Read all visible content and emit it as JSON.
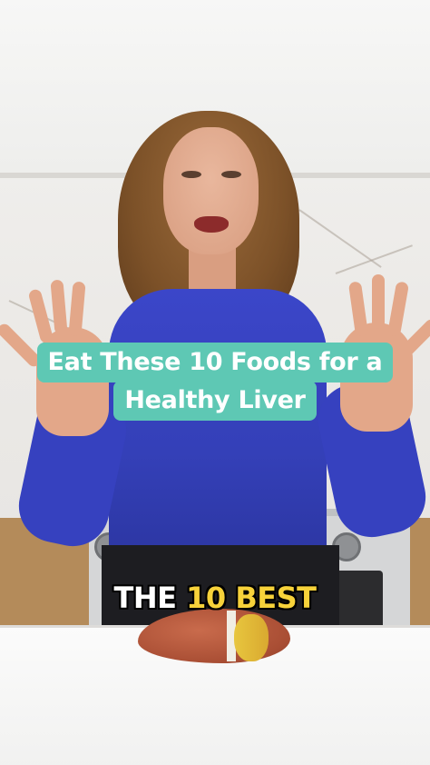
{
  "caption": {
    "title_line_1": "Eat These 10 Foods for a",
    "title_line_2": "Healthy Liver",
    "title_background": "#5ec8b4",
    "subtitle_part_1": "THE ",
    "subtitle_part_2": "10 BEST",
    "subtitle_color_1": "#ffffff",
    "subtitle_color_2": "#f7d23a"
  },
  "scene": {
    "description_icons": [
      "presenter",
      "liver-model",
      "kitchen-background"
    ]
  }
}
